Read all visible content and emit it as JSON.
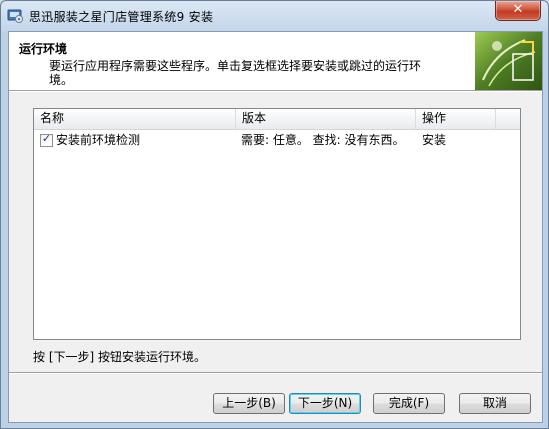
{
  "window": {
    "title": "思迅服装之星门店管理系统9 安装",
    "close_glyph": "✕"
  },
  "header": {
    "title": "运行环境",
    "description": "要运行应用程序需要这些程序。单击复选框选择要安装或跳过的运行环境。"
  },
  "list": {
    "columns": [
      "名称",
      "版本",
      "操作"
    ],
    "rows": [
      {
        "checked": true,
        "name": "安装前环境检测",
        "version": "需要: 任意。 查找: 没有东西。",
        "action": "安装"
      }
    ]
  },
  "hint": "按 [下一步] 按钮安装运行环境。",
  "buttons": {
    "back": "上一步(B)",
    "next": "下一步(N)",
    "finish": "完成(F)",
    "cancel": "取消"
  },
  "icons": {
    "app": "installer-icon",
    "close": "close-icon",
    "header": "header-graphic",
    "check": "checkmark-icon"
  },
  "colors": {
    "titlebar": "#c4d6ea",
    "close": "#c8432b",
    "default_button_border": "#3c7fb1"
  }
}
